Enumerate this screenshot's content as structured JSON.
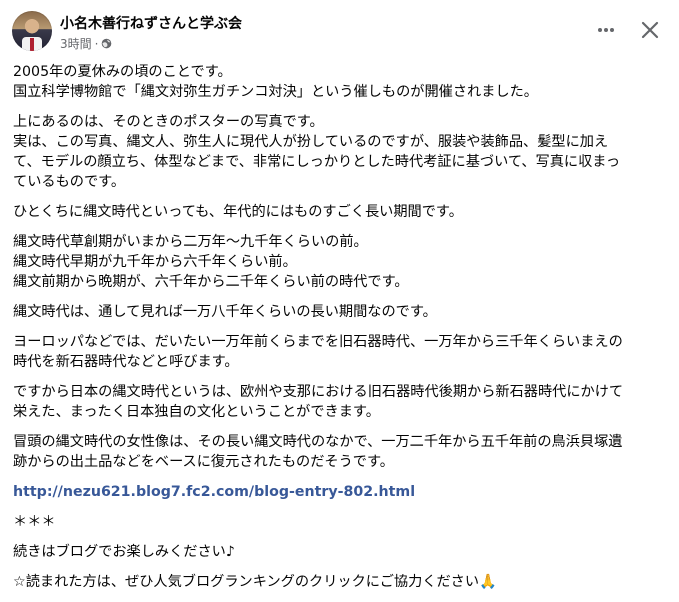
{
  "header": {
    "group_name": "小名木善行ねずさんと学ぶ会",
    "time": "3時間",
    "separator": "·",
    "privacy_icon": "globe-icon",
    "more_icon": "more-horizontal-icon",
    "close_icon": "close-icon"
  },
  "post": {
    "paragraphs": [
      "2005年の夏休みの頃のことです。\n国立科学博物館で「縄文対弥生ガチンコ対決」という催しものが開催されました。",
      "上にあるのは、そのときのポスターの写真です。\n実は、この写真、縄文人、弥生人に現代人が扮しているのですが、服装や装飾品、髪型に加え\nて、モデルの顔立ち、体型などまで、非常にしっかりとした時代考証に基づいて、写真に収まっ\nているものです。",
      "ひとくちに縄文時代といっても、年代的にはものすごく長い期間です。",
      "縄文時代草創期がいまから二万年〜九千年くらいの前。\n縄文時代早期が九千年から六千年くらい前。\n縄文前期から晩期が、六千年から二千年くらい前の時代です。",
      "縄文時代は、通して見れば一万八千年くらいの長い期間なのです。",
      "ヨーロッパなどでは、だいたい一万年前くらまでを旧石器時代、一万年から三千年くらいまえの\n時代を新石器時代などと呼びます。",
      "ですから日本の縄文時代というは、欧州や支那における旧石器時代後期から新石器時代にかけて\n栄えた、まったく日本独自の文化ということができます。",
      "冒頭の縄文時代の女性像は、その長い縄文時代のなかで、一万二千年から五千年前の鳥浜貝塚遺\n跡からの出土品などをベースに復元されたものだそうです。"
    ],
    "link": "http://nezu621.blog7.fc2.com/blog-entry-802.html",
    "divider": "＊＊＊",
    "continue_text": "続きはブログでお楽しみください♪",
    "request_text": "☆読まれた方は、ぜひ人気ブログランキングのクリックにご協力ください",
    "request_emoji": "🙏"
  }
}
